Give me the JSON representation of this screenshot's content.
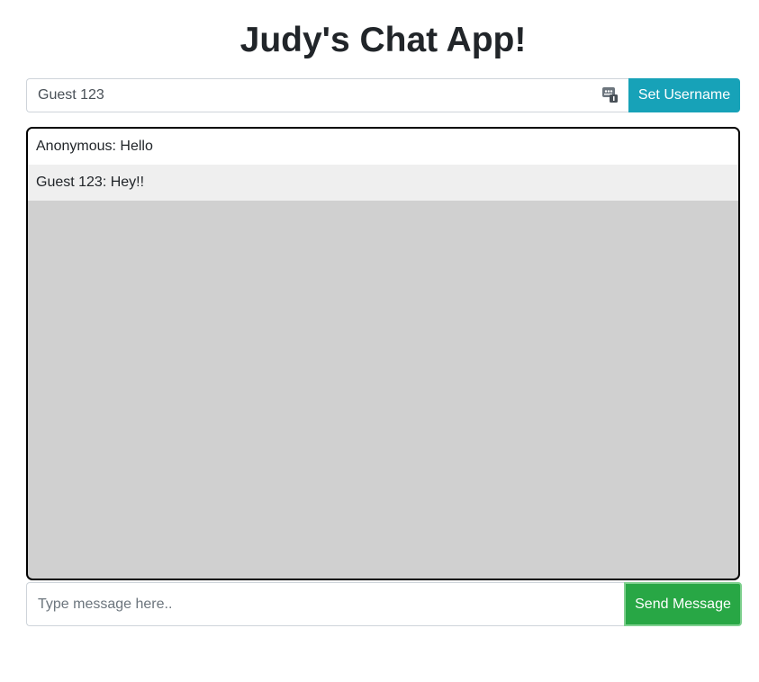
{
  "header": {
    "title": "Judy's Chat App!"
  },
  "username": {
    "value": "Guest 123",
    "icon": "contact-card-icon",
    "button_label": "Set Username"
  },
  "messages": [
    {
      "text": "Anonymous: Hello"
    },
    {
      "text": "Guest 123: Hey!!"
    }
  ],
  "composer": {
    "placeholder": "Type message here..",
    "value": "",
    "button_label": "Send Message"
  },
  "colors": {
    "set_username_button": "#17a2b8",
    "send_button": "#28a745",
    "chat_background": "#d0d0d0"
  }
}
